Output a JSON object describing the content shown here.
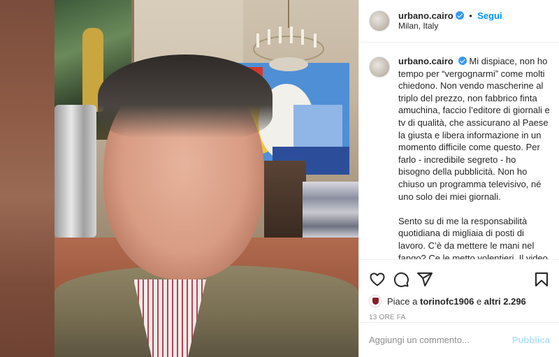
{
  "post": {
    "username": "urbano.cairo",
    "follow_label": "Segui",
    "separator": "•",
    "location": "Milan, Italy"
  },
  "caption": {
    "username": "urbano.cairo",
    "text": "Mi dispiace, non ho tempo per “vergognarmi” come molti chiedono. Non vendo mascherine al triplo del prezzo, non fabbrico finta amuchina, faccio l’editore di giornali e tv di qualità, che assicurano al Paese la giusta e libera informazione in un momento difficile come questo. Per farlo - incredibile segreto - ho bisogno della pubblicità. Non ho chiuso un programma televisivo, né uno solo dei miei giornali.\n\nSento su di me la responsabilità quotidiana di migliaia di posti di lavoro. C’è da mettere le mani nel fango? Ce le metto volentieri. Il video che è uscito era una riunione di spogliatoio. Non doveva essere pubblicato. E nello"
  },
  "likes": {
    "prefix": "Piace a",
    "user": "torinofc1906",
    "middle": "e",
    "others": "altri 2.296"
  },
  "timestamp": "13 ORE FA",
  "comment_box": {
    "placeholder": "Aggiungi un commento...",
    "publish_label": "Pubblica"
  },
  "icons": {
    "like": "heart-icon",
    "comment": "comment-icon",
    "share": "share-icon",
    "save": "bookmark-icon"
  },
  "colors": {
    "link_blue": "#0095f6",
    "publish_disabled": "#b2dffc",
    "verified_blue": "#3897f0",
    "muted": "#8e8e8e"
  }
}
